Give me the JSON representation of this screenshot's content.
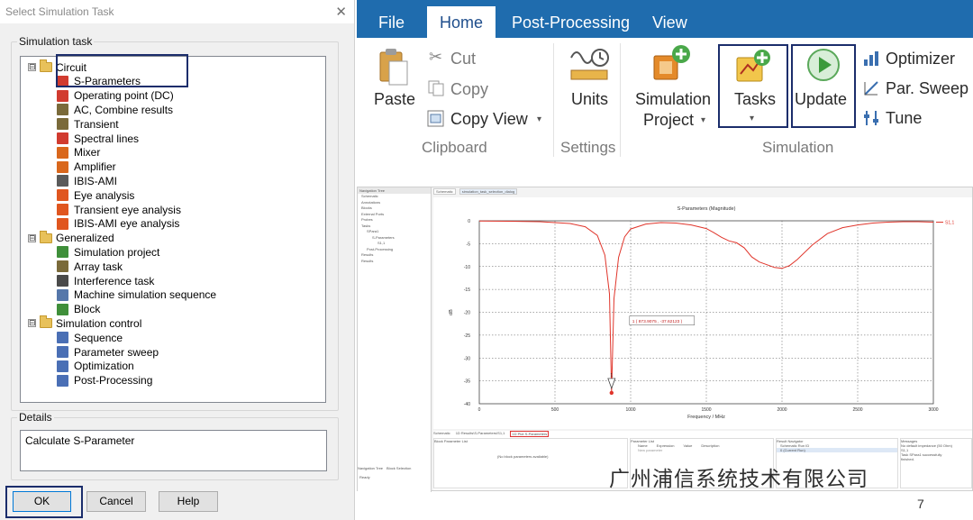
{
  "dialog": {
    "title": "Select Simulation Task",
    "close_glyph": "✕",
    "group_label": "Simulation task",
    "categories": [
      {
        "label": "Circuit",
        "expander": "⊟",
        "items": [
          {
            "label": "S-Parameters",
            "icon": "s-parameters-icon",
            "color": "#d13b2f"
          },
          {
            "label": "Operating point (DC)",
            "icon": "operating-point-icon",
            "color": "#d13b2f"
          },
          {
            "label": "AC, Combine results",
            "icon": "ac-icon",
            "color": "#7a6a3a"
          },
          {
            "label": "Transient",
            "icon": "transient-icon",
            "color": "#7a6a3a"
          },
          {
            "label": "Spectral lines",
            "icon": "spectral-lines-icon",
            "color": "#d13b2f"
          },
          {
            "label": "Mixer",
            "icon": "mixer-icon",
            "color": "#d9671c"
          },
          {
            "label": "Amplifier",
            "icon": "amplifier-icon",
            "color": "#d9671c"
          },
          {
            "label": "IBIS-AMI",
            "icon": "ibis-ami-icon",
            "color": "#5a5a5a"
          },
          {
            "label": "Eye analysis",
            "icon": "eye-analysis-icon",
            "color": "#e0561f"
          },
          {
            "label": "Transient eye analysis",
            "icon": "transient-eye-icon",
            "color": "#e0561f"
          },
          {
            "label": "IBIS-AMI eye analysis",
            "icon": "ibis-eye-icon",
            "color": "#e0561f"
          }
        ]
      },
      {
        "label": "Generalized",
        "expander": "⊟",
        "items": [
          {
            "label": "Simulation project",
            "icon": "simulation-project-icon",
            "color": "#3f8f3a"
          },
          {
            "label": "Array task",
            "icon": "array-task-icon",
            "color": "#7a6a3a"
          },
          {
            "label": "Interference task",
            "icon": "interference-task-icon",
            "color": "#4a4a4a"
          },
          {
            "label": "Machine simulation sequence",
            "icon": "machine-sequence-icon",
            "color": "#5577aa"
          },
          {
            "label": "Block",
            "icon": "block-icon",
            "color": "#3f8f3a"
          }
        ]
      },
      {
        "label": "Simulation control",
        "expander": "⊟",
        "items": [
          {
            "label": "Sequence",
            "icon": "sequence-icon",
            "color": "#4a6fb5"
          },
          {
            "label": "Parameter sweep",
            "icon": "parameter-sweep-icon",
            "color": "#4a6fb5"
          },
          {
            "label": "Optimization",
            "icon": "optimization-icon",
            "color": "#4a6fb5"
          },
          {
            "label": "Post-Processing",
            "icon": "post-processing-icon",
            "color": "#4a6fb5"
          }
        ]
      }
    ],
    "details_label": "Details",
    "details_text": "Calculate S-Parameter",
    "buttons": {
      "ok": "OK",
      "cancel": "Cancel",
      "help": "Help"
    }
  },
  "ribbon": {
    "tabs": [
      "File",
      "Home",
      "Post-Processing",
      "View"
    ],
    "active_tab": "Home",
    "clipboard": {
      "paste": "Paste",
      "cut": "Cut",
      "copy": "Copy",
      "copy_view": "Copy View",
      "group": "Clipboard"
    },
    "settings": {
      "units": "Units",
      "group": "Settings"
    },
    "simulation": {
      "project_line1": "Simulation",
      "project_line2": "Project",
      "tasks": "Tasks",
      "update": "Update",
      "optimizer": "Optimizer",
      "par_sweep": "Par. Sweep",
      "tune": "Tune",
      "group": "Simulation"
    },
    "dropdown_glyph": "▾",
    "colors": {
      "tab_bar": "#1f6cae",
      "highlight": "#1b2d6b"
    }
  },
  "app": {
    "nav_title": "Navigation Tree",
    "nav_items": [
      "Schematic",
      "Annotations",
      "Blocks",
      "External Ports",
      "Probes",
      "Tasks",
      "SPara1",
      "S-Parameters",
      "S1,1",
      "Post-Processing",
      "Results",
      "Results"
    ],
    "doc_tabs": [
      "Schematic",
      "simulation_task_selection_dialog"
    ],
    "bottom_tabs": [
      "Schematic",
      "1D Results\\S-Parameters\\S1,1",
      "1D Plot S-Parameters"
    ],
    "panes": {
      "block_params": "Block Parameter List",
      "block_params_hint": "(No block parameters available)",
      "param_list": "Parameter List",
      "param_cols": [
        "Name",
        "Expression",
        "Value",
        "Description"
      ],
      "param_hint": "New parameter",
      "result_navigator": "Result Navigator",
      "result_items": [
        "Schematic Run ID",
        "0 (Current Run)"
      ],
      "messages": "Messages",
      "messages_items": [
        "No default impedance (50 Ohm)",
        "S1,1",
        "Task SPara1 successfully",
        "finished."
      ],
      "nav_tabs": [
        "Navigation Tree",
        "Block Selection"
      ],
      "status": "Ready"
    }
  },
  "chart_data": {
    "type": "line",
    "title": "S-Parameters (Magnitude)",
    "xlabel": "Frequency / MHz",
    "ylabel": "dB",
    "xlim": [
      0,
      3000
    ],
    "ylim": [
      -40,
      0
    ],
    "x_ticks": [
      "0",
      "500",
      "1000",
      "1500",
      "2000",
      "2500",
      "3000"
    ],
    "y_ticks": [
      "0",
      "-5",
      "-10",
      "-15",
      "-20",
      "-25",
      "-30",
      "-35",
      "-40"
    ],
    "series": [
      {
        "name": "S1,1",
        "color": "#e0352b",
        "x": [
          0,
          200,
          400,
          600,
          700,
          780,
          830,
          860,
          873.9,
          890,
          920,
          960,
          1000,
          1100,
          1200,
          1300,
          1400,
          1500,
          1550,
          1600,
          1650,
          1700,
          1750,
          1800,
          1850,
          1900,
          1950,
          2000,
          2050,
          2100,
          2200,
          2300,
          2400,
          2500,
          2600,
          2700,
          2800,
          2900,
          3000
        ],
        "y": [
          -0.05,
          -0.1,
          -0.2,
          -0.6,
          -1.3,
          -3.2,
          -7.5,
          -16.0,
          -37.6,
          -17.0,
          -8.0,
          -3.5,
          -1.8,
          -0.7,
          -0.4,
          -0.5,
          -0.9,
          -1.7,
          -2.6,
          -3.6,
          -4.4,
          -4.8,
          -5.9,
          -7.9,
          -9.0,
          -9.6,
          -10.2,
          -10.4,
          -9.8,
          -8.5,
          -5.3,
          -2.8,
          -1.5,
          -0.9,
          -0.5,
          -0.3,
          -0.2,
          -0.2,
          -0.3
        ]
      }
    ],
    "marker": {
      "label": "1",
      "x": 873.9075,
      "y": -37.62123,
      "readout": "1 ( 873.9075 , -37.62123 )"
    },
    "grid": true,
    "legend": "right"
  },
  "watermark": "广州浦信系统技术有限公司",
  "page_number": "7"
}
